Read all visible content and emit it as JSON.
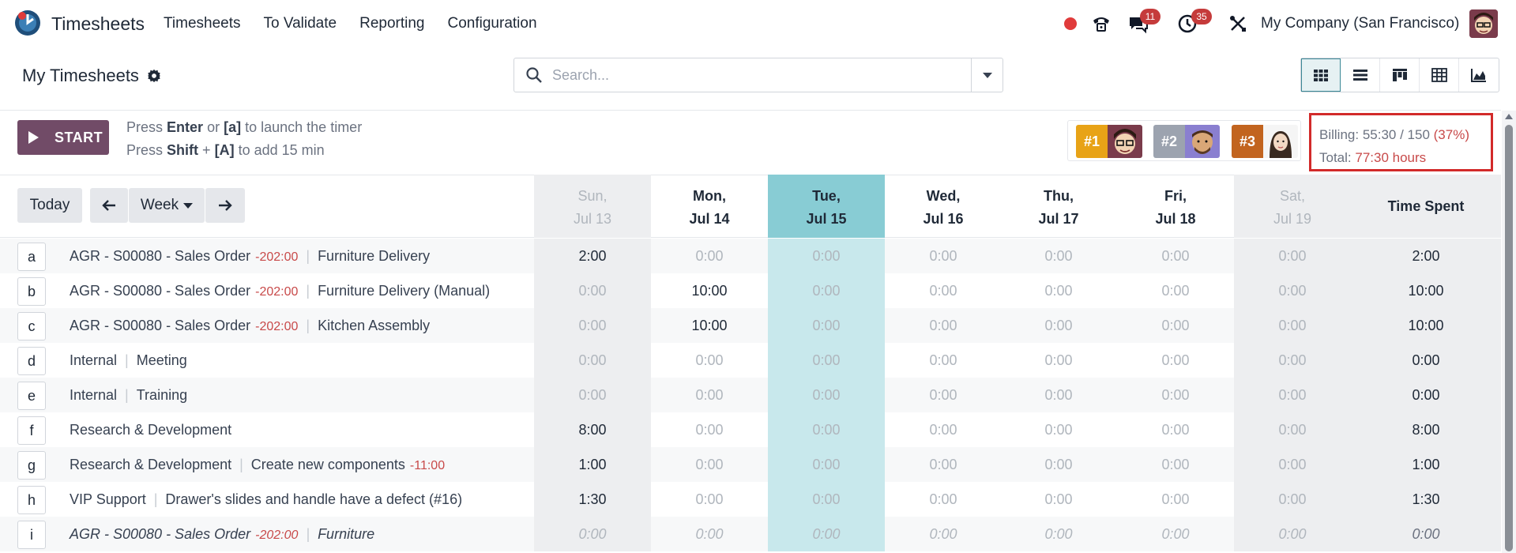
{
  "navbar": {
    "app_name": "Timesheets",
    "menu": [
      "Timesheets",
      "To Validate",
      "Reporting",
      "Configuration"
    ],
    "messages_count": "11",
    "activities_count": "35",
    "company": "My Company (San Francisco)"
  },
  "control_panel": {
    "title": "My Timesheets",
    "search_placeholder": "Search..."
  },
  "timer": {
    "start_label": "START",
    "hint1": {
      "press": "Press",
      "key1": "Enter",
      "or": "or",
      "key2": "[a]",
      "rest": "to launch the timer"
    },
    "hint2": {
      "press": "Press",
      "key1": "Shift",
      "plus": "+",
      "key2": "[A]",
      "rest": "to add 15 min"
    }
  },
  "leaderboard": [
    {
      "rank": "#1",
      "color": "#e8a317"
    },
    {
      "rank": "#2",
      "color": "#9ca3af"
    },
    {
      "rank": "#3",
      "color": "#c2641f"
    }
  ],
  "billing": {
    "billing_label": "Billing:",
    "billing_value": "55:30 / 150",
    "billing_pct": "(37%)",
    "total_label": "Total:",
    "total_value": "77:30 hours"
  },
  "grid": {
    "today_label": "Today",
    "range_label": "Week",
    "days": [
      {
        "l1": "Sun,",
        "l2": "Jul 13"
      },
      {
        "l1": "Mon,",
        "l2": "Jul 14"
      },
      {
        "l1": "Tue,",
        "l2": "Jul 15"
      },
      {
        "l1": "Wed,",
        "l2": "Jul 16"
      },
      {
        "l1": "Thu,",
        "l2": "Jul 17"
      },
      {
        "l1": "Fri,",
        "l2": "Jul 18"
      },
      {
        "l1": "Sat,",
        "l2": "Jul 19"
      }
    ],
    "time_spent_label": "Time Spent",
    "rows": [
      {
        "key": "a",
        "project": "AGR - S00080 - Sales Order",
        "project_remaining": "-202:00",
        "task": "Furniture Delivery",
        "task_remaining": "",
        "cells": [
          "2:00",
          "0:00",
          "0:00",
          "0:00",
          "0:00",
          "0:00",
          "0:00"
        ],
        "total": "2:00"
      },
      {
        "key": "b",
        "project": "AGR - S00080 - Sales Order",
        "project_remaining": "-202:00",
        "task": "Furniture Delivery (Manual)",
        "task_remaining": "",
        "cells": [
          "0:00",
          "10:00",
          "0:00",
          "0:00",
          "0:00",
          "0:00",
          "0:00"
        ],
        "total": "10:00"
      },
      {
        "key": "c",
        "project": "AGR - S00080 - Sales Order",
        "project_remaining": "-202:00",
        "task": "Kitchen Assembly",
        "task_remaining": "",
        "cells": [
          "0:00",
          "10:00",
          "0:00",
          "0:00",
          "0:00",
          "0:00",
          "0:00"
        ],
        "total": "10:00"
      },
      {
        "key": "d",
        "project": "Internal",
        "project_remaining": "",
        "task": "Meeting",
        "task_remaining": "",
        "cells": [
          "0:00",
          "0:00",
          "0:00",
          "0:00",
          "0:00",
          "0:00",
          "0:00"
        ],
        "total": "0:00"
      },
      {
        "key": "e",
        "project": "Internal",
        "project_remaining": "",
        "task": "Training",
        "task_remaining": "",
        "cells": [
          "0:00",
          "0:00",
          "0:00",
          "0:00",
          "0:00",
          "0:00",
          "0:00"
        ],
        "total": "0:00"
      },
      {
        "key": "f",
        "project": "Research & Development",
        "project_remaining": "",
        "task": "",
        "task_remaining": "",
        "cells": [
          "8:00",
          "0:00",
          "0:00",
          "0:00",
          "0:00",
          "0:00",
          "0:00"
        ],
        "total": "8:00"
      },
      {
        "key": "g",
        "project": "Research & Development",
        "project_remaining": "",
        "task": "Create new components",
        "task_remaining": "-11:00",
        "cells": [
          "1:00",
          "0:00",
          "0:00",
          "0:00",
          "0:00",
          "0:00",
          "0:00"
        ],
        "total": "1:00"
      },
      {
        "key": "h",
        "project": "VIP Support",
        "project_remaining": "",
        "task": "Drawer's slides and handle have a defect (#16)",
        "task_remaining": "",
        "cells": [
          "1:30",
          "0:00",
          "0:00",
          "0:00",
          "0:00",
          "0:00",
          "0:00"
        ],
        "total": "1:30"
      },
      {
        "key": "i",
        "project": "AGR - S00080 - Sales Order",
        "project_remaining": "-202:00",
        "task": "Furniture",
        "task_remaining": "",
        "cells": [
          "0:00",
          "0:00",
          "0:00",
          "0:00",
          "0:00",
          "0:00",
          "0:00"
        ],
        "total": "0:00",
        "italic": true
      }
    ]
  },
  "colors": {
    "primary": "#714b67",
    "today_header": "#88ccd4",
    "today_cell": "#c8e8ec",
    "negative": "#c84a4a",
    "highlight_border": "#d22a2a"
  }
}
